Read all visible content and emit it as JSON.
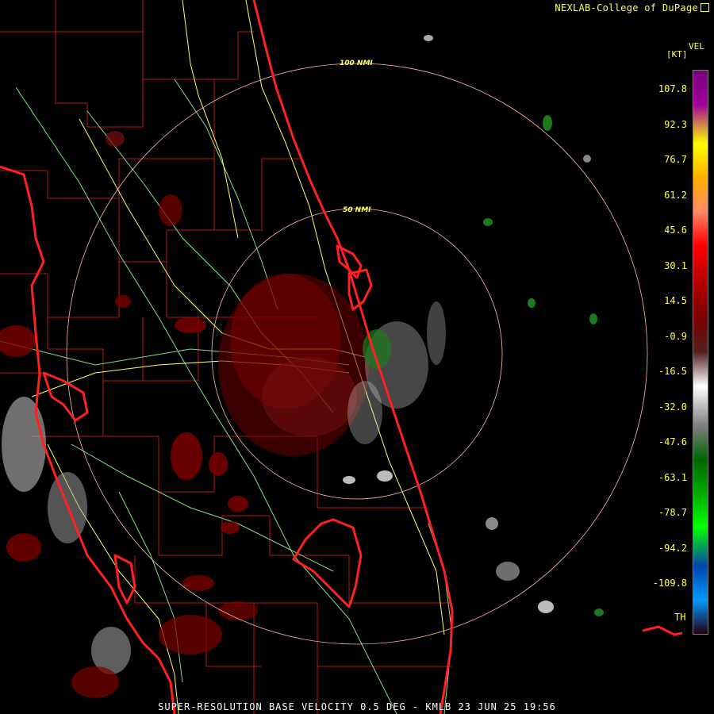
{
  "header": {
    "credit": "NEXLAB-College of DuPage"
  },
  "footer": {
    "caption": "SUPER-RESOLUTION BASE VELOCITY 0.5 DEG - KMLB 23 JUN 25 19:56"
  },
  "rings": [
    {
      "label": "100 NMI"
    },
    {
      "label": "50 NMI"
    }
  ],
  "legend": {
    "title_top": "VEL",
    "unit": "[KT]",
    "ticks": [
      "107.8",
      "92.3",
      "76.7",
      "61.2",
      "45.6",
      "30.1",
      "14.5",
      "-0.9",
      "-16.5",
      "-32.0",
      "-47.6",
      "-63.1",
      "-78.7",
      "-94.2",
      "-109.8"
    ],
    "th_label": "TH",
    "colors": [
      "#7a007a",
      "#a0009a",
      "#ffff00",
      "#ffb000",
      "#ff8866",
      "#ff0000",
      "#b00000",
      "#7a0000",
      "#552020",
      "#ffffff",
      "#808080",
      "#006600",
      "#00aa00",
      "#00ff00",
      "#0044aa",
      "#0099ff",
      "#200010"
    ]
  },
  "palette": {
    "coast": "#ff2020",
    "county": "#b01818",
    "highway": "#ffff66",
    "road": "#88dd88",
    "ring": "#ffbbaa",
    "text": "#ffff55"
  }
}
